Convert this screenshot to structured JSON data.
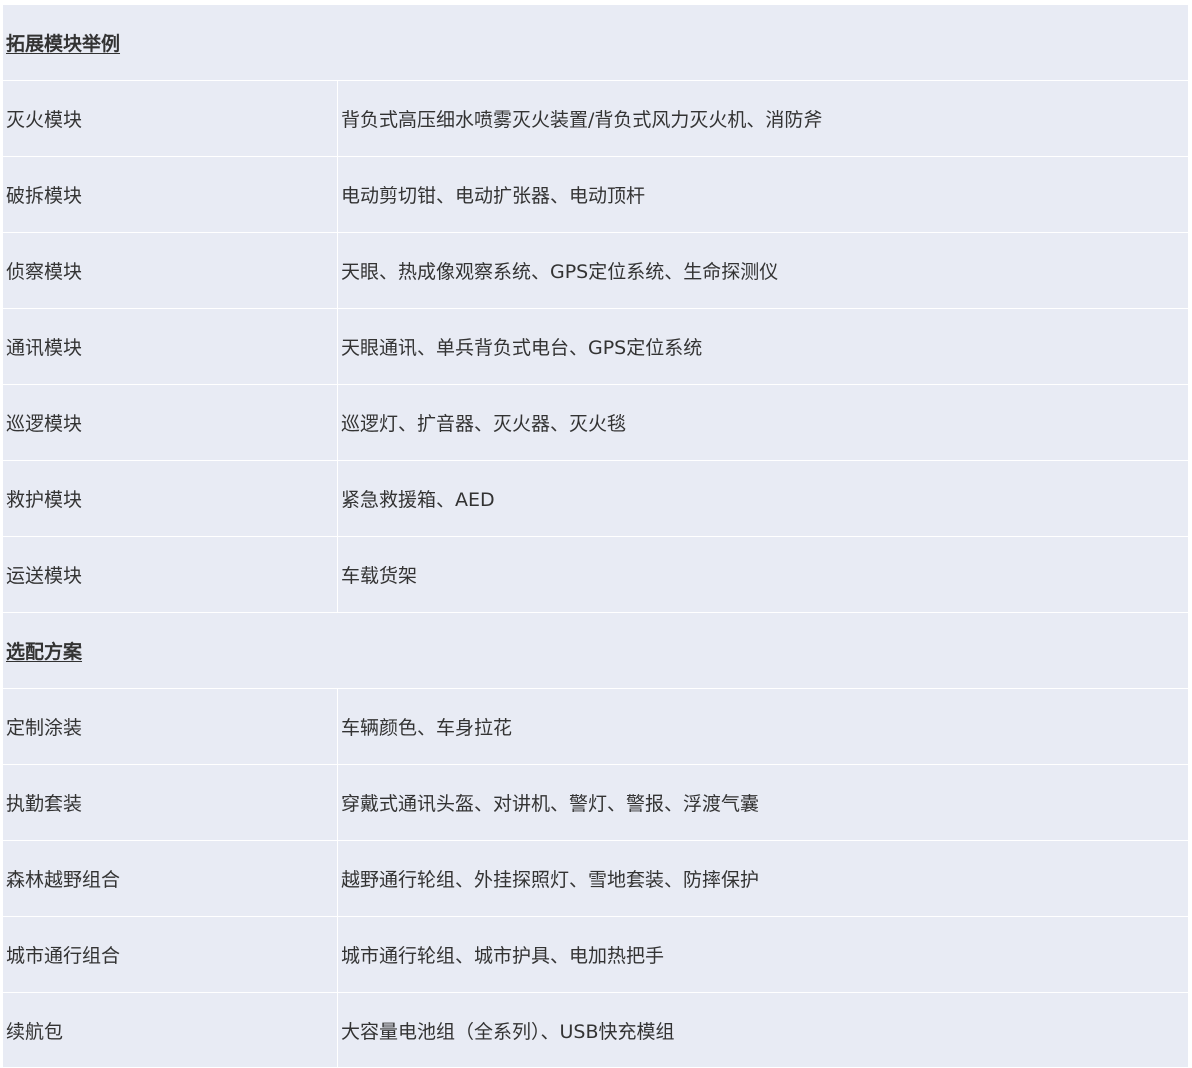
{
  "sections": [
    {
      "title": "拓展模块举例",
      "rows": [
        {
          "name": "灭火模块",
          "desc": "背负式高压细水喷雾灭火装置/背负式风力灭火机、消防斧"
        },
        {
          "name": "破拆模块",
          "desc": "电动剪切钳、电动扩张器、电动顶杆"
        },
        {
          "name": "侦察模块",
          "desc": "天眼、热成像观察系统、GPS定位系统、生命探测仪"
        },
        {
          "name": "通讯模块",
          "desc": "天眼通讯、单兵背负式电台、GPS定位系统"
        },
        {
          "name": "巡逻模块",
          "desc": "巡逻灯、扩音器、灭火器、灭火毯"
        },
        {
          "name": "救护模块",
          "desc": "紧急救援箱、AED"
        },
        {
          "name": "运送模块",
          "desc": "车载货架"
        }
      ]
    },
    {
      "title": "选配方案",
      "rows": [
        {
          "name": "定制涂装",
          "desc": "车辆颜色、车身拉花"
        },
        {
          "name": "执勤套装",
          "desc": "穿戴式通讯头盔、对讲机、警灯、警报、浮渡气囊"
        },
        {
          "name": "森林越野组合",
          "desc": "越野通行轮组、外挂探照灯、雪地套装、防摔保护"
        },
        {
          "name": "城市通行组合",
          "desc": "城市通行轮组、城市护具、电加热把手"
        },
        {
          "name": "续航包",
          "desc": "大容量电池组（全系列）、USB快充模组"
        }
      ]
    }
  ]
}
